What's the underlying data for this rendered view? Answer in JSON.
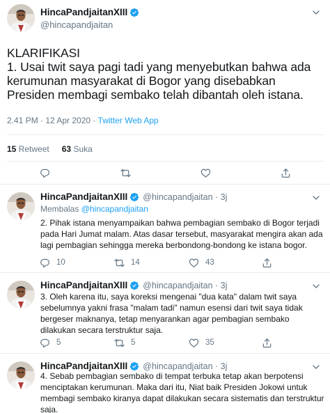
{
  "colors": {
    "accent": "#1da1f2",
    "muted": "#657786",
    "text": "#14171a",
    "border": "#e6ecf0"
  },
  "main_tweet": {
    "display_name": "HincaPandjaitanXIII",
    "handle": "@hincapandjaitan",
    "verified_icon": "verified-badge-icon",
    "menu_icon": "chevron-down-icon",
    "text": "KLARIFIKASI\n1. Usai twit saya pagi tadi yang menyebutkan bahwa ada kerumunan masyarakat di Bogor yang disebabkan Presiden membagi sembako telah dibantah oleh istana.",
    "time_date": "2.41 PM · 12 Apr 2020 · ",
    "source": "Twitter Web App",
    "retweets_count": "15",
    "retweets_label": "Retweet",
    "likes_count": "63",
    "likes_label": "Suka",
    "actions": [
      "reply-icon",
      "retweet-icon",
      "like-icon",
      "share-icon"
    ]
  },
  "replies": [
    {
      "display_name": "HincaPandjaitanXIII",
      "handle": "@hincapandjaitan · 3j",
      "replying_prefix": "Membalas ",
      "replying_to": "@hincapandjaitan",
      "text": "2. Pihak istana menyampaikan bahwa pembagian sembako di Bogor terjadi pada Hari Jumat malam. Atas dasar tersebut, masyarakat mengira akan ada lagi pembagian sehingga mereka berbondong-bondong ke istana bogor.",
      "reply_count": "10",
      "retweet_count": "14",
      "like_count": "43"
    },
    {
      "display_name": "HincaPandjaitanXIII",
      "handle": "@hincapandjaitan · 3j",
      "text": "3. Oleh karena itu, saya koreksi mengenai \"dua kata\" dalam twit saya sebelumnya yakni frasa \"malam tadi\" namun esensi dari twit saya tidak bergeser maknanya, tetap menyarankan agar pembagian sembako dilakukan secara terstruktur saja.",
      "reply_count": "5",
      "retweet_count": "5",
      "like_count": "35"
    },
    {
      "display_name": "HincaPandjaitanXIII",
      "handle": "@hincapandjaitan · 3j",
      "text": "4. Sebab pembagian sembako di tempat terbuka tetap akan berpotensi menciptakan kerumunan. Maka dari itu, Niat baik Presiden Jokowi untuk membagi sembako kiranya dapat dilakukan secara sistematis dan terstruktur saja."
    }
  ]
}
